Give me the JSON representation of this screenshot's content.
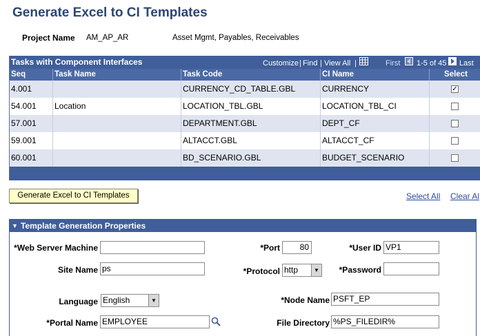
{
  "page": {
    "title": "Generate Excel to CI Templates"
  },
  "project": {
    "label": "Project Name",
    "value": "AM_AP_AR",
    "description": "Asset Mgmt, Payables, Receivables"
  },
  "grid": {
    "title": "Tasks with Component Interfaces",
    "nav": {
      "customize": "Customize",
      "find": "Find",
      "view_all": "View All",
      "first": "First",
      "range": "1-5 of 45",
      "last": "Last"
    },
    "columns": [
      "Seq",
      "Task Name",
      "Task Code",
      "CI Name",
      "Select"
    ],
    "rows": [
      {
        "seq": "4.001",
        "task_name": "",
        "task_code": "CURRENCY_CD_TABLE.GBL",
        "ci_name": "CURRENCY",
        "checked": true,
        "check_mark": "✓"
      },
      {
        "seq": "54.001",
        "task_name": "Location",
        "task_code": "LOCATION_TBL.GBL",
        "ci_name": "LOCATION_TBL_CI",
        "checked": false,
        "check_mark": ""
      },
      {
        "seq": "57.001",
        "task_name": "",
        "task_code": "DEPARTMENT.GBL",
        "ci_name": "DEPT_CF",
        "checked": false,
        "check_mark": ""
      },
      {
        "seq": "59.001",
        "task_name": "",
        "task_code": "ALTACCT.GBL",
        "ci_name": "ALTACCT_CF",
        "checked": false,
        "check_mark": ""
      },
      {
        "seq": "60.001",
        "task_name": "",
        "task_code": "BD_SCENARIO.GBL",
        "ci_name": "BUDGET_SCENARIO",
        "checked": false,
        "check_mark": ""
      }
    ]
  },
  "actions": {
    "generate": "Generate Excel to CI Templates",
    "select_all": "Select All",
    "clear_all": "Clear Al"
  },
  "panel": {
    "title": "Template Generation Properties",
    "collapse_glyph": "▼",
    "web_server_machine": {
      "label": "*Web Server Machine",
      "value": ""
    },
    "port": {
      "label": "*Port",
      "value": "80"
    },
    "user_id": {
      "label": "*User ID",
      "value": "VP1"
    },
    "site_name": {
      "label": "Site Name",
      "value": "ps"
    },
    "protocol": {
      "label": "*Protocol",
      "value": "http"
    },
    "password": {
      "label": "*Password",
      "value": ""
    },
    "language": {
      "label": "Language",
      "value": "English"
    },
    "node_name": {
      "label": "*Node Name",
      "value": "PSFT_EP"
    },
    "portal_name": {
      "label": "*Portal Name",
      "value": "EMPLOYEE"
    },
    "file_directory": {
      "label": "File Directory",
      "value": "%PS_FILEDIR%"
    }
  },
  "icons": {
    "view_all_grid": "grid-icon",
    "prev": "arrow-left-icon",
    "next": "arrow-right-icon",
    "lookup": "search-icon",
    "dropdown": "chevron-down-icon"
  },
  "colors": {
    "title": "#2b4675",
    "grid_header": "#3f5e9a",
    "row_alt": "#dfe4f0",
    "button": "#ffffc8",
    "link": "#2b4b9a"
  }
}
